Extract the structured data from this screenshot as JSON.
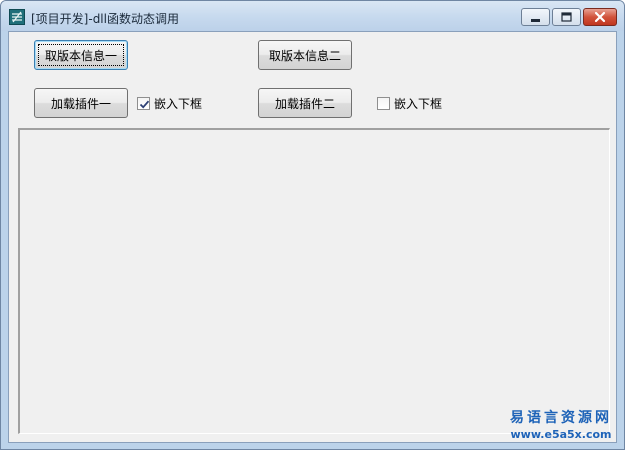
{
  "window": {
    "title": "[项目开发]-dll函数动态调用",
    "icon": "app-logo-icon",
    "controls": {
      "minimize": "minimize-icon",
      "maximize": "maximize-icon",
      "close": "close-icon"
    }
  },
  "buttons": {
    "get_version_1": "取版本信息一",
    "get_version_2": "取版本信息二",
    "load_plugin_1": "加载插件一",
    "load_plugin_2": "加载插件二"
  },
  "checkboxes": {
    "embed_1": {
      "label": "嵌入下框",
      "checked": true
    },
    "embed_2": {
      "label": "嵌入下框",
      "checked": false
    }
  },
  "watermark": {
    "site_name": "易语言资源网",
    "url": "www.e5a5x.com"
  },
  "colors": {
    "watermark": "#1e63b8",
    "close_button": "#c0361f",
    "titlebar": "#c6d9ee"
  }
}
